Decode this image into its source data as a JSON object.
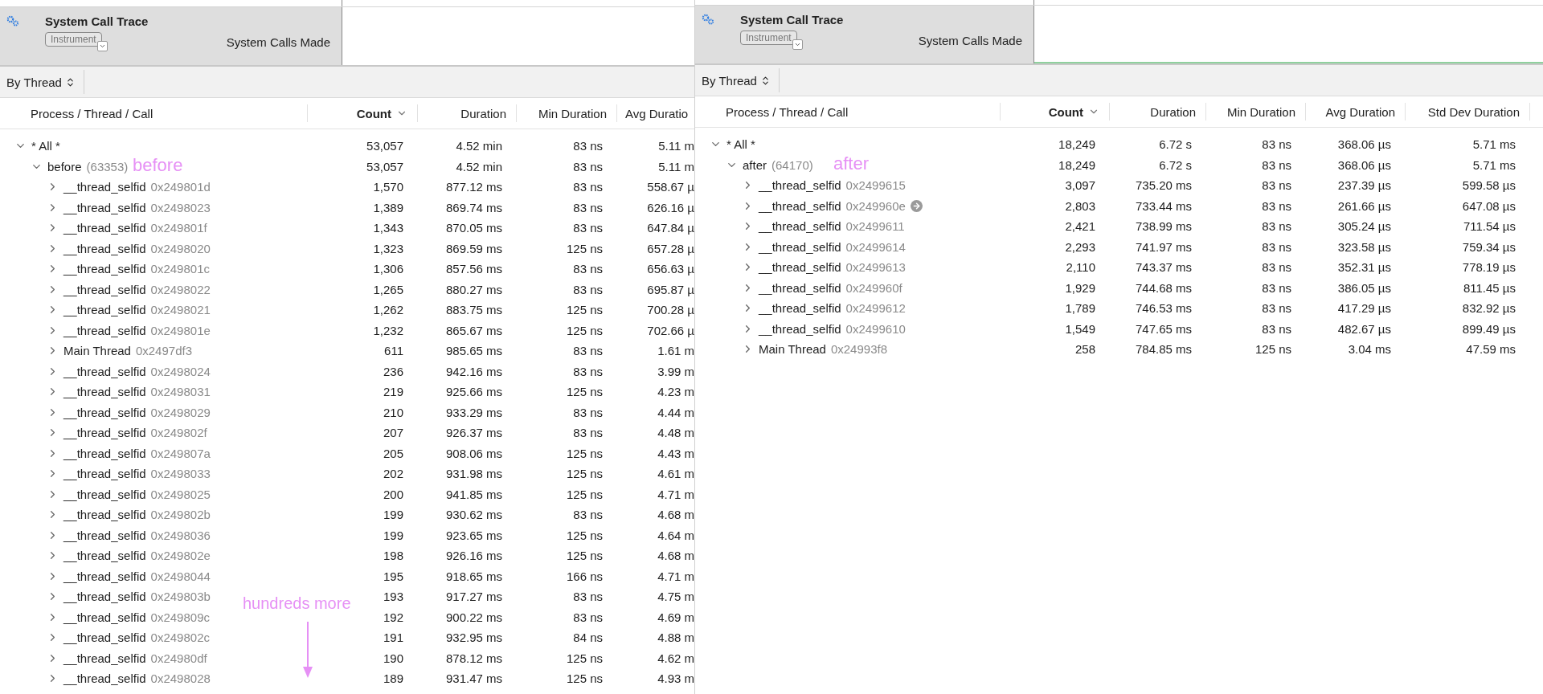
{
  "panels": [
    {
      "instrument": {
        "title": "System Call Trace",
        "badge": "Instrument",
        "track_label": "System Calls Made"
      },
      "toolbar": {
        "grouping": "By Thread"
      },
      "columns": [
        {
          "label": "Process / Thread / Call",
          "sorted": false
        },
        {
          "label": "Count",
          "sorted": true
        },
        {
          "label": "Duration",
          "sorted": false
        },
        {
          "label": "Min Duration",
          "sorted": false
        },
        {
          "label": "Avg Duratio",
          "sorted": false
        }
      ],
      "note": {
        "text": "hundreds more",
        "arrow": true
      },
      "rows": [
        {
          "name": "* All *",
          "expanded": true,
          "values": [
            "53,057",
            "4.52 min",
            "83 ns",
            "5.11 m"
          ],
          "children": [
            {
              "name": "before",
              "detail": "(63353)",
              "annotation": "before",
              "expanded": true,
              "values": [
                "53,057",
                "4.52 min",
                "83 ns",
                "5.11 m"
              ],
              "children": [
                {
                  "name": "__thread_selfid",
                  "detail": "0x249801d",
                  "expanded": false,
                  "values": [
                    "1,570",
                    "877.12 ms",
                    "83 ns",
                    "558.67 µ"
                  ]
                },
                {
                  "name": "__thread_selfid",
                  "detail": "0x2498023",
                  "expanded": false,
                  "values": [
                    "1,389",
                    "869.74 ms",
                    "83 ns",
                    "626.16 µ"
                  ]
                },
                {
                  "name": "__thread_selfid",
                  "detail": "0x249801f",
                  "expanded": false,
                  "values": [
                    "1,343",
                    "870.05 ms",
                    "83 ns",
                    "647.84 µ"
                  ]
                },
                {
                  "name": "__thread_selfid",
                  "detail": "0x2498020",
                  "expanded": false,
                  "values": [
                    "1,323",
                    "869.59 ms",
                    "125 ns",
                    "657.28 µ"
                  ]
                },
                {
                  "name": "__thread_selfid",
                  "detail": "0x249801c",
                  "expanded": false,
                  "values": [
                    "1,306",
                    "857.56 ms",
                    "83 ns",
                    "656.63 µ"
                  ]
                },
                {
                  "name": "__thread_selfid",
                  "detail": "0x2498022",
                  "expanded": false,
                  "values": [
                    "1,265",
                    "880.27 ms",
                    "83 ns",
                    "695.87 µ"
                  ]
                },
                {
                  "name": "__thread_selfid",
                  "detail": "0x2498021",
                  "expanded": false,
                  "values": [
                    "1,262",
                    "883.75 ms",
                    "125 ns",
                    "700.28 µ"
                  ]
                },
                {
                  "name": "__thread_selfid",
                  "detail": "0x249801e",
                  "expanded": false,
                  "values": [
                    "1,232",
                    "865.67 ms",
                    "125 ns",
                    "702.66 µ"
                  ]
                },
                {
                  "name": "Main Thread",
                  "detail": "0x2497df3",
                  "expanded": false,
                  "values": [
                    "611",
                    "985.65 ms",
                    "83 ns",
                    "1.61 m"
                  ]
                },
                {
                  "name": "__thread_selfid",
                  "detail": "0x2498024",
                  "expanded": false,
                  "values": [
                    "236",
                    "942.16 ms",
                    "83 ns",
                    "3.99 m"
                  ]
                },
                {
                  "name": "__thread_selfid",
                  "detail": "0x2498031",
                  "expanded": false,
                  "values": [
                    "219",
                    "925.66 ms",
                    "125 ns",
                    "4.23 m"
                  ]
                },
                {
                  "name": "__thread_selfid",
                  "detail": "0x2498029",
                  "expanded": false,
                  "values": [
                    "210",
                    "933.29 ms",
                    "83 ns",
                    "4.44 m"
                  ]
                },
                {
                  "name": "__thread_selfid",
                  "detail": "0x249802f",
                  "expanded": false,
                  "values": [
                    "207",
                    "926.37 ms",
                    "83 ns",
                    "4.48 m"
                  ]
                },
                {
                  "name": "__thread_selfid",
                  "detail": "0x249807a",
                  "expanded": false,
                  "values": [
                    "205",
                    "908.06 ms",
                    "125 ns",
                    "4.43 m"
                  ]
                },
                {
                  "name": "__thread_selfid",
                  "detail": "0x2498033",
                  "expanded": false,
                  "values": [
                    "202",
                    "931.98 ms",
                    "125 ns",
                    "4.61 m"
                  ]
                },
                {
                  "name": "__thread_selfid",
                  "detail": "0x2498025",
                  "expanded": false,
                  "values": [
                    "200",
                    "941.85 ms",
                    "125 ns",
                    "4.71 m"
                  ]
                },
                {
                  "name": "__thread_selfid",
                  "detail": "0x249802b",
                  "expanded": false,
                  "values": [
                    "199",
                    "930.62 ms",
                    "83 ns",
                    "4.68 m"
                  ]
                },
                {
                  "name": "__thread_selfid",
                  "detail": "0x2498036",
                  "expanded": false,
                  "values": [
                    "199",
                    "923.65 ms",
                    "125 ns",
                    "4.64 m"
                  ]
                },
                {
                  "name": "__thread_selfid",
                  "detail": "0x249802e",
                  "expanded": false,
                  "values": [
                    "198",
                    "926.16 ms",
                    "125 ns",
                    "4.68 m"
                  ]
                },
                {
                  "name": "__thread_selfid",
                  "detail": "0x2498044",
                  "expanded": false,
                  "values": [
                    "195",
                    "918.65 ms",
                    "166 ns",
                    "4.71 m"
                  ]
                },
                {
                  "name": "__thread_selfid",
                  "detail": "0x249803b",
                  "expanded": false,
                  "values": [
                    "193",
                    "917.27 ms",
                    "83 ns",
                    "4.75 m"
                  ]
                },
                {
                  "name": "__thread_selfid",
                  "detail": "0x249809c",
                  "expanded": false,
                  "values": [
                    "192",
                    "900.22 ms",
                    "83 ns",
                    "4.69 m"
                  ]
                },
                {
                  "name": "__thread_selfid",
                  "detail": "0x249802c",
                  "expanded": false,
                  "values": [
                    "191",
                    "932.95 ms",
                    "84 ns",
                    "4.88 m"
                  ]
                },
                {
                  "name": "__thread_selfid",
                  "detail": "0x24980df",
                  "expanded": false,
                  "values": [
                    "190",
                    "878.12 ms",
                    "125 ns",
                    "4.62 m"
                  ]
                },
                {
                  "name": "__thread_selfid",
                  "detail": "0x2498028",
                  "expanded": false,
                  "values": [
                    "189",
                    "931.47 ms",
                    "125 ns",
                    "4.93 m"
                  ]
                }
              ]
            }
          ]
        }
      ]
    },
    {
      "instrument": {
        "title": "System Call Trace",
        "badge": "Instrument",
        "track_label": "System Calls Made"
      },
      "toolbar": {
        "grouping": "By Thread"
      },
      "columns": [
        {
          "label": "Process / Thread / Call",
          "sorted": false
        },
        {
          "label": "Count",
          "sorted": true
        },
        {
          "label": "Duration",
          "sorted": false
        },
        {
          "label": "Min Duration",
          "sorted": false
        },
        {
          "label": "Avg Duration",
          "sorted": false
        },
        {
          "label": "Std Dev Duration",
          "sorted": false
        }
      ],
      "rows": [
        {
          "name": "* All *",
          "expanded": true,
          "values": [
            "18,249",
            "6.72 s",
            "83 ns",
            "368.06 µs",
            "5.71 ms"
          ],
          "children": [
            {
              "name": "after",
              "detail": "(64170)",
              "annotation": "after",
              "expanded": true,
              "values": [
                "18,249",
                "6.72 s",
                "83 ns",
                "368.06 µs",
                "5.71 ms"
              ],
              "children": [
                {
                  "name": "__thread_selfid",
                  "detail": "0x2499615",
                  "expanded": false,
                  "hovered": false,
                  "values": [
                    "3,097",
                    "735.20 ms",
                    "83 ns",
                    "237.39 µs",
                    "599.58 µs"
                  ]
                },
                {
                  "name": "__thread_selfid",
                  "detail": "0x249960e",
                  "expanded": false,
                  "hovered": true,
                  "values": [
                    "2,803",
                    "733.44 ms",
                    "83 ns",
                    "261.66 µs",
                    "647.08 µs"
                  ]
                },
                {
                  "name": "__thread_selfid",
                  "detail": "0x2499611",
                  "expanded": false,
                  "hovered": false,
                  "values": [
                    "2,421",
                    "738.99 ms",
                    "83 ns",
                    "305.24 µs",
                    "711.54 µs"
                  ]
                },
                {
                  "name": "__thread_selfid",
                  "detail": "0x2499614",
                  "expanded": false,
                  "hovered": false,
                  "values": [
                    "2,293",
                    "741.97 ms",
                    "83 ns",
                    "323.58 µs",
                    "759.34 µs"
                  ]
                },
                {
                  "name": "__thread_selfid",
                  "detail": "0x2499613",
                  "expanded": false,
                  "hovered": false,
                  "values": [
                    "2,110",
                    "743.37 ms",
                    "83 ns",
                    "352.31 µs",
                    "778.19 µs"
                  ]
                },
                {
                  "name": "__thread_selfid",
                  "detail": "0x249960f",
                  "expanded": false,
                  "hovered": false,
                  "values": [
                    "1,929",
                    "744.68 ms",
                    "83 ns",
                    "386.05 µs",
                    "811.45 µs"
                  ]
                },
                {
                  "name": "__thread_selfid",
                  "detail": "0x2499612",
                  "expanded": false,
                  "hovered": false,
                  "values": [
                    "1,789",
                    "746.53 ms",
                    "83 ns",
                    "417.29 µs",
                    "832.92 µs"
                  ]
                },
                {
                  "name": "__thread_selfid",
                  "detail": "0x2499610",
                  "expanded": false,
                  "hovered": false,
                  "values": [
                    "1,549",
                    "747.65 ms",
                    "83 ns",
                    "482.67 µs",
                    "899.49 µs"
                  ]
                },
                {
                  "name": "Main Thread",
                  "detail": "0x24993f8",
                  "expanded": false,
                  "hovered": false,
                  "values": [
                    "258",
                    "784.85 ms",
                    "125 ns",
                    "3.04 ms",
                    "47.59 ms"
                  ]
                }
              ]
            }
          ]
        }
      ]
    }
  ]
}
